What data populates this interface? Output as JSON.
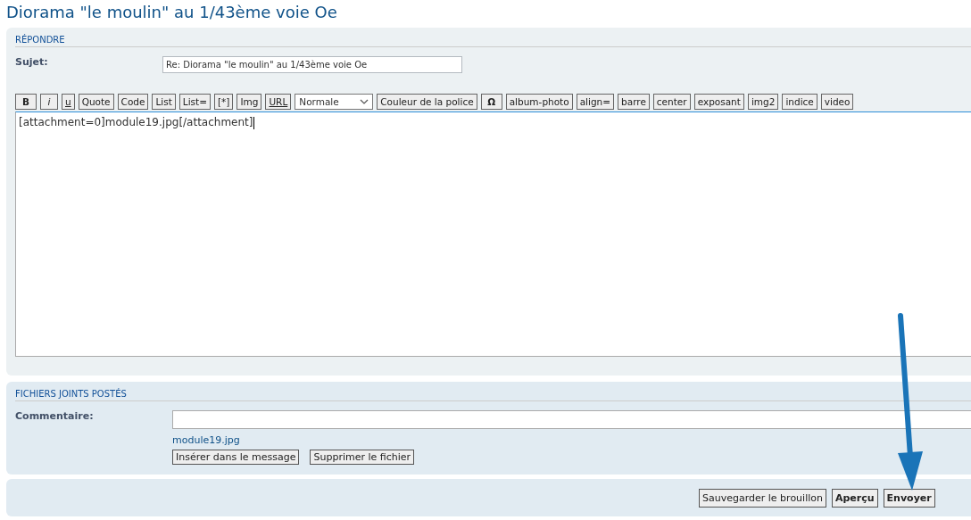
{
  "page_title": "Diorama \"le moulin\" au 1/43ème voie Oe",
  "reply": {
    "heading": "RÉPONDRE",
    "subject_label": "Sujet:",
    "subject_value": "Re: Diorama \"le moulin\" au 1/43ème voie Oe",
    "toolbar": [
      {
        "label": "B",
        "kind": "bold"
      },
      {
        "label": "i",
        "kind": "italic"
      },
      {
        "label": "u",
        "kind": "underline"
      },
      {
        "label": "Quote",
        "kind": "plain"
      },
      {
        "label": "Code",
        "kind": "plain"
      },
      {
        "label": "List",
        "kind": "plain"
      },
      {
        "label": "List=",
        "kind": "plain"
      },
      {
        "label": "[*]",
        "kind": "plain"
      },
      {
        "label": "Img",
        "kind": "plain"
      },
      {
        "label": "URL",
        "kind": "underline"
      },
      {
        "label": "Normale",
        "kind": "select"
      },
      {
        "label": "Couleur de la police",
        "kind": "plain"
      },
      {
        "label": "Ω",
        "kind": "bold"
      },
      {
        "label": "album-photo",
        "kind": "plain"
      },
      {
        "label": "align=",
        "kind": "plain"
      },
      {
        "label": "barre",
        "kind": "plain"
      },
      {
        "label": "center",
        "kind": "plain"
      },
      {
        "label": "exposant",
        "kind": "plain"
      },
      {
        "label": "img2",
        "kind": "plain"
      },
      {
        "label": "indice",
        "kind": "plain"
      },
      {
        "label": "video",
        "kind": "plain"
      }
    ],
    "message": "[attachment=0]module19.jpg[/attachment]"
  },
  "attachments": {
    "heading": "FICHIERS JOINTS POSTÉS",
    "comment_label": "Commentaire:",
    "file_name": "module19.jpg",
    "buttons": [
      "Insérer dans le message",
      "Supprimer le fichier"
    ]
  },
  "actions": [
    {
      "label": "Sauvegarder le brouillon",
      "primary": false
    },
    {
      "label": "Aperçu",
      "primary": true
    },
    {
      "label": "Envoyer",
      "primary": true
    }
  ]
}
